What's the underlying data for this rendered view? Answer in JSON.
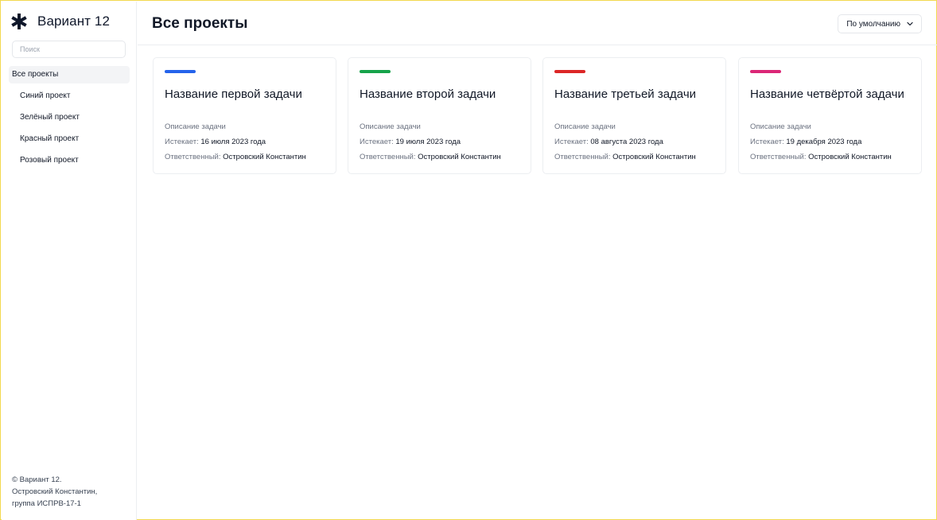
{
  "app": {
    "title": "Вариант 12",
    "logo_icon": "asterisk-icon"
  },
  "sidebar": {
    "search_placeholder": "Поиск",
    "items": [
      {
        "label": "Все проекты",
        "active": true
      },
      {
        "label": "Синий проект"
      },
      {
        "label": "Зелёный проект"
      },
      {
        "label": "Красный проект"
      },
      {
        "label": "Розовый проект"
      }
    ],
    "footer": {
      "line1": "© Вариант 12.",
      "line2": "Островский Константин,",
      "line3": "группа ИСПРВ-17-1"
    }
  },
  "header": {
    "title": "Все проекты",
    "sort": {
      "label": "По умолчанию",
      "icon": "chevron-down-icon"
    }
  },
  "card_labels": {
    "expires": "Истекает:",
    "owner": "Ответственный:"
  },
  "tasks": [
    {
      "title": "Название первой задачи",
      "color": "#2563eb",
      "description": "Описание задачи",
      "expires": "16 июля 2023 года",
      "owner": "Островский Константин"
    },
    {
      "title": "Название второй задачи",
      "color": "#16a34a",
      "description": "Описание задачи",
      "expires": "19 июля 2023 года",
      "owner": "Островский Константин"
    },
    {
      "title": "Название третьей задачи",
      "color": "#dc2626",
      "description": "Описание задачи",
      "expires": "08 августа 2023 года",
      "owner": "Островский Константин"
    },
    {
      "title": "Название четвёртой задачи",
      "color": "#db2777",
      "description": "Описание задачи",
      "expires": "19 декабря 2023 года",
      "owner": "Островский Константин"
    }
  ]
}
